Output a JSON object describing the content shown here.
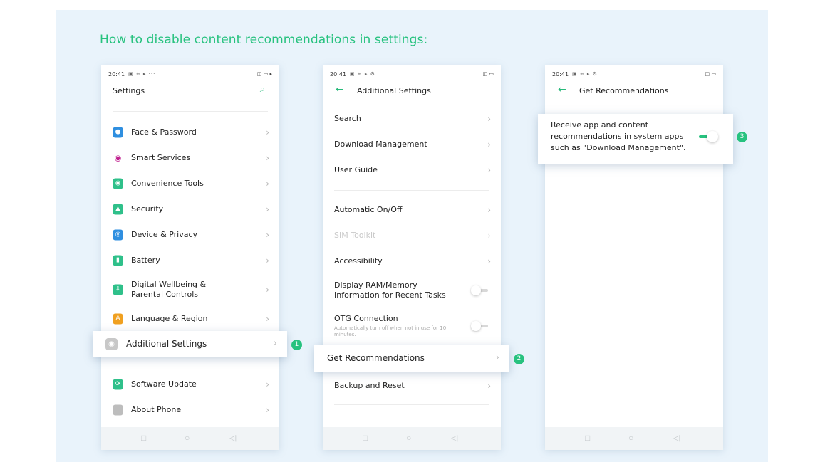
{
  "page_title": "How to disable content recommendations in settings:",
  "accent_color": "#27c27f",
  "status": {
    "time": "20:41",
    "left_icons_1": "▣ ≋ ▸ ···",
    "left_icons_2": "▣ ≋ ▸ ⚙",
    "right_icons_1": "◫ ▭ ▸",
    "right_icons_2": "◫ ▭"
  },
  "phone1": {
    "header_title": "Settings",
    "search_icon": "⌕",
    "items": [
      {
        "label": "Face & Password",
        "icon": "person-icon",
        "icon_color": "#2f8fe0",
        "glyph": "👤"
      },
      {
        "label": "Smart Services",
        "icon": "dot-icon",
        "icon_color": "#ffffff",
        "glyph": "●"
      },
      {
        "label": "Convenience Tools",
        "icon": "tools-icon",
        "icon_color": "#2fc08a",
        "glyph": "◉"
      },
      {
        "label": "Security",
        "icon": "shield-icon",
        "icon_color": "#2fc08a",
        "glyph": "⛨"
      },
      {
        "label": "Device & Privacy",
        "icon": "privacy-icon",
        "icon_color": "#2f8fe0",
        "glyph": "◎"
      },
      {
        "label": "Battery",
        "icon": "battery-icon",
        "icon_color": "#2fc08a",
        "glyph": "▮"
      },
      {
        "label": "Digital Wellbeing & Parental Controls",
        "icon": "wellbeing-icon",
        "icon_color": "#2fc08a",
        "glyph": "⬇"
      },
      {
        "label": "Language & Region",
        "icon": "language-icon",
        "icon_color": "#f0a020",
        "glyph": "A"
      }
    ],
    "bottom_items": [
      {
        "label": "Software Update",
        "icon": "update-icon",
        "icon_color": "#2fc08a",
        "glyph": "⟳"
      },
      {
        "label": "About Phone",
        "icon": "info-icon",
        "icon_color": "#bdbdbd",
        "glyph": "i"
      }
    ],
    "callout": {
      "label": "Additional Settings",
      "glyph": "◉",
      "step": "1"
    }
  },
  "phone2": {
    "header_title": "Additional Settings",
    "items_top": [
      "Search",
      "Download Management",
      "User Guide"
    ],
    "automatic": "Automatic On/Off",
    "sim": "SIM Toolkit",
    "accessibility": "Accessibility",
    "ram": "Display RAM/Memory Information for Recent Tasks",
    "otg": "OTG Connection",
    "otg_sub": "Automatically turn off when not in use for 10 minutes.",
    "backup": "Backup and Reset",
    "callout": {
      "label": "Get Recommendations",
      "step": "2"
    }
  },
  "phone3": {
    "header_title": "Get Recommendations",
    "callout": {
      "text": "Receive app and content recommendations in system apps such as \"Download Management\".",
      "step": "3",
      "toggle_on": true
    }
  },
  "nav": {
    "square": "□",
    "circle": "○",
    "back": "◁"
  },
  "chevron": "›",
  "back_arrow": "←"
}
